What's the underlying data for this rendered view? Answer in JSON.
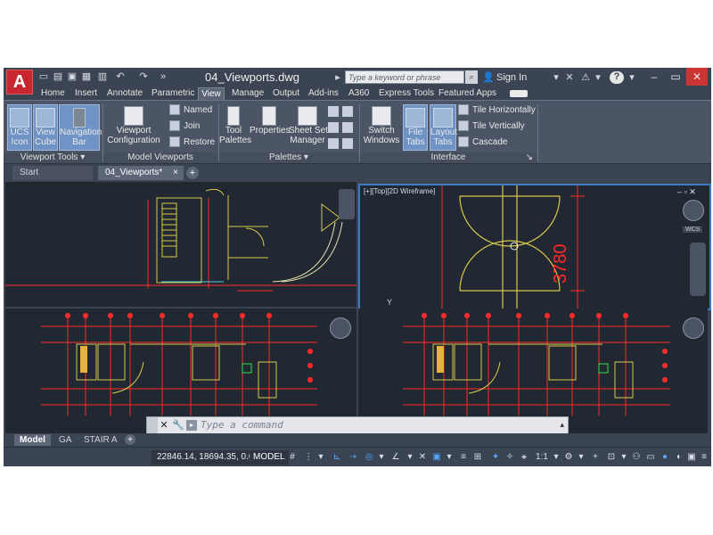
{
  "title_bar": {
    "app_menu_label": "A",
    "document_title": "04_Viewports.dwg",
    "search_placeholder": "Type a keyword or phrase",
    "sign_in": "Sign In",
    "help": "?"
  },
  "ribbon_tabs": [
    {
      "label": "Home"
    },
    {
      "label": "Insert"
    },
    {
      "label": "Annotate"
    },
    {
      "label": "Parametric"
    },
    {
      "label": "View"
    },
    {
      "label": "Manage"
    },
    {
      "label": "Output"
    },
    {
      "label": "Add-ins"
    },
    {
      "label": "A360"
    },
    {
      "label": "Express Tools"
    },
    {
      "label": "Featured Apps"
    }
  ],
  "ribbon": {
    "viewport_tools": {
      "title": "Viewport Tools",
      "ucs_icon": "UCS\nIcon",
      "view_cube": "View\nCube",
      "navigation_bar": "Navigation\nBar"
    },
    "model_viewports": {
      "title": "Model Viewports",
      "viewport_configuration": "Viewport\nConfiguration",
      "named": "Named",
      "join": "Join",
      "restore": "Restore"
    },
    "palettes": {
      "title": "Palettes",
      "tool_palettes": "Tool\nPalettes",
      "properties": "Properties",
      "sheet_set_manager": "Sheet Set\nManager"
    },
    "interface": {
      "title": "Interface",
      "switch_windows": "Switch\nWindows",
      "file_tabs": "File\nTabs",
      "layout_tabs": "Layout\nTabs",
      "tile_horizontally": "Tile Horizontally",
      "tile_vertically": "Tile Vertically",
      "cascade": "Cascade"
    }
  },
  "file_tabs": {
    "start": "Start",
    "document": "04_Viewports*",
    "close": "×",
    "add": "+"
  },
  "viewport2": {
    "label": "[+][Top][2D Wireframe]",
    "dimension_value": "3780",
    "wcs": "WCS"
  },
  "command_line": {
    "placeholder": "Type a command"
  },
  "layout_tabs": [
    {
      "label": "Model",
      "active": true
    },
    {
      "label": "GA"
    },
    {
      "label": "STAIR A"
    }
  ],
  "status_bar": {
    "coordinates": "22846.14, 18694.35, 0.00",
    "model": "MODEL",
    "scale": "1:1"
  },
  "colors": {
    "accent": "#3e7bc6",
    "drawing_red": "#ff2a2a",
    "drawing_yellow": "#d8c84a",
    "app_red": "#c8262e"
  }
}
